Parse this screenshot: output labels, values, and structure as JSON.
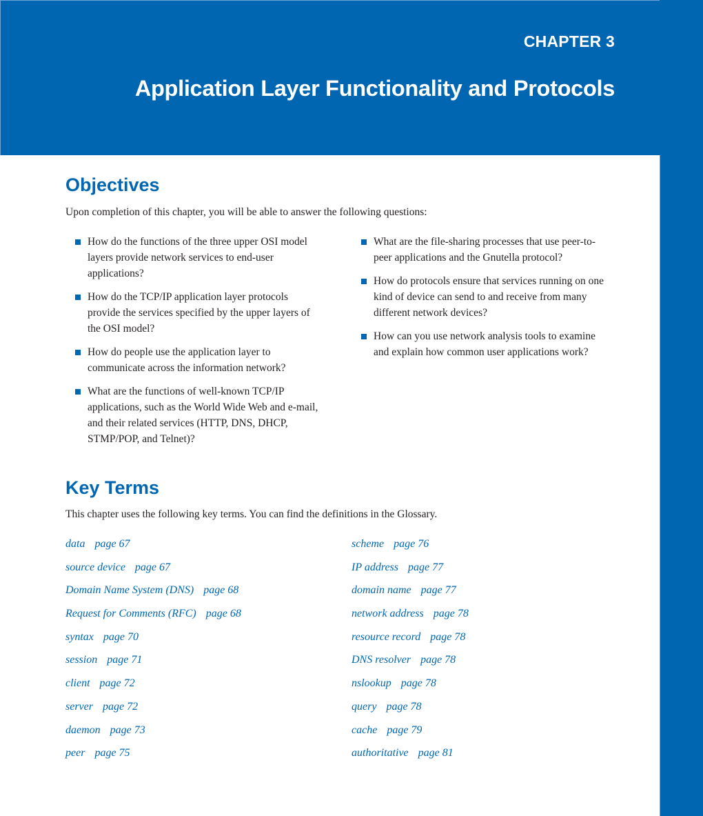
{
  "header": {
    "chapter_label": "CHAPTER 3",
    "chapter_title": "Application Layer Functionality and Protocols"
  },
  "colors": {
    "brand_blue": "#0066b1",
    "body_text": "#231f20",
    "background": "#ffffff"
  },
  "objectives": {
    "heading": "Objectives",
    "intro": "Upon completion of this chapter, you will be able to answer the following questions:",
    "left_items": [
      "How do the functions of the three upper OSI model layers provide network services to end-user applications?",
      "How do the TCP/IP application layer protocols provide the services specified by the upper layers of the OSI model?",
      "How do people use the application layer to communicate across the information network?",
      "What are the functions of well-known TCP/IP applications, such as the World Wide Web and e-mail, and their related services (HTTP, DNS, DHCP, STMP/POP, and Telnet)?"
    ],
    "right_items": [
      "What are the file-sharing processes that use peer-to-peer applications and the Gnutella protocol?",
      "How do protocols ensure that services running on one kind of device can send to and receive from many different network devices?",
      "How can you use network analysis tools to examine and explain how common user applications work?"
    ]
  },
  "key_terms": {
    "heading": "Key Terms",
    "intro": "This chapter uses the following key terms. You can find the definitions in the Glossary.",
    "left_terms": [
      {
        "term": "data",
        "page": "page 67"
      },
      {
        "term": "source device",
        "page": "page 67"
      },
      {
        "term": "Domain Name System (DNS)",
        "page": "page 68"
      },
      {
        "term": "Request for Comments (RFC)",
        "page": "page 68"
      },
      {
        "term": "syntax",
        "page": "page 70"
      },
      {
        "term": "session",
        "page": "page 71"
      },
      {
        "term": "client",
        "page": "page 72"
      },
      {
        "term": "server",
        "page": "page 72"
      },
      {
        "term": "daemon",
        "page": "page 73"
      },
      {
        "term": "peer",
        "page": "page 75"
      }
    ],
    "right_terms": [
      {
        "term": "scheme",
        "page": "page 76"
      },
      {
        "term": "IP address",
        "page": "page 77"
      },
      {
        "term": "domain name",
        "page": "page 77"
      },
      {
        "term": "network address",
        "page": "page 78"
      },
      {
        "term": "resource record",
        "page": "page 78"
      },
      {
        "term": "DNS resolver",
        "page": "page 78"
      },
      {
        "term": "nslookup",
        "page": "page 78"
      },
      {
        "term": "query",
        "page": "page 78"
      },
      {
        "term": "cache",
        "page": "page 79"
      },
      {
        "term": "authoritative",
        "page": "page 81"
      }
    ]
  }
}
